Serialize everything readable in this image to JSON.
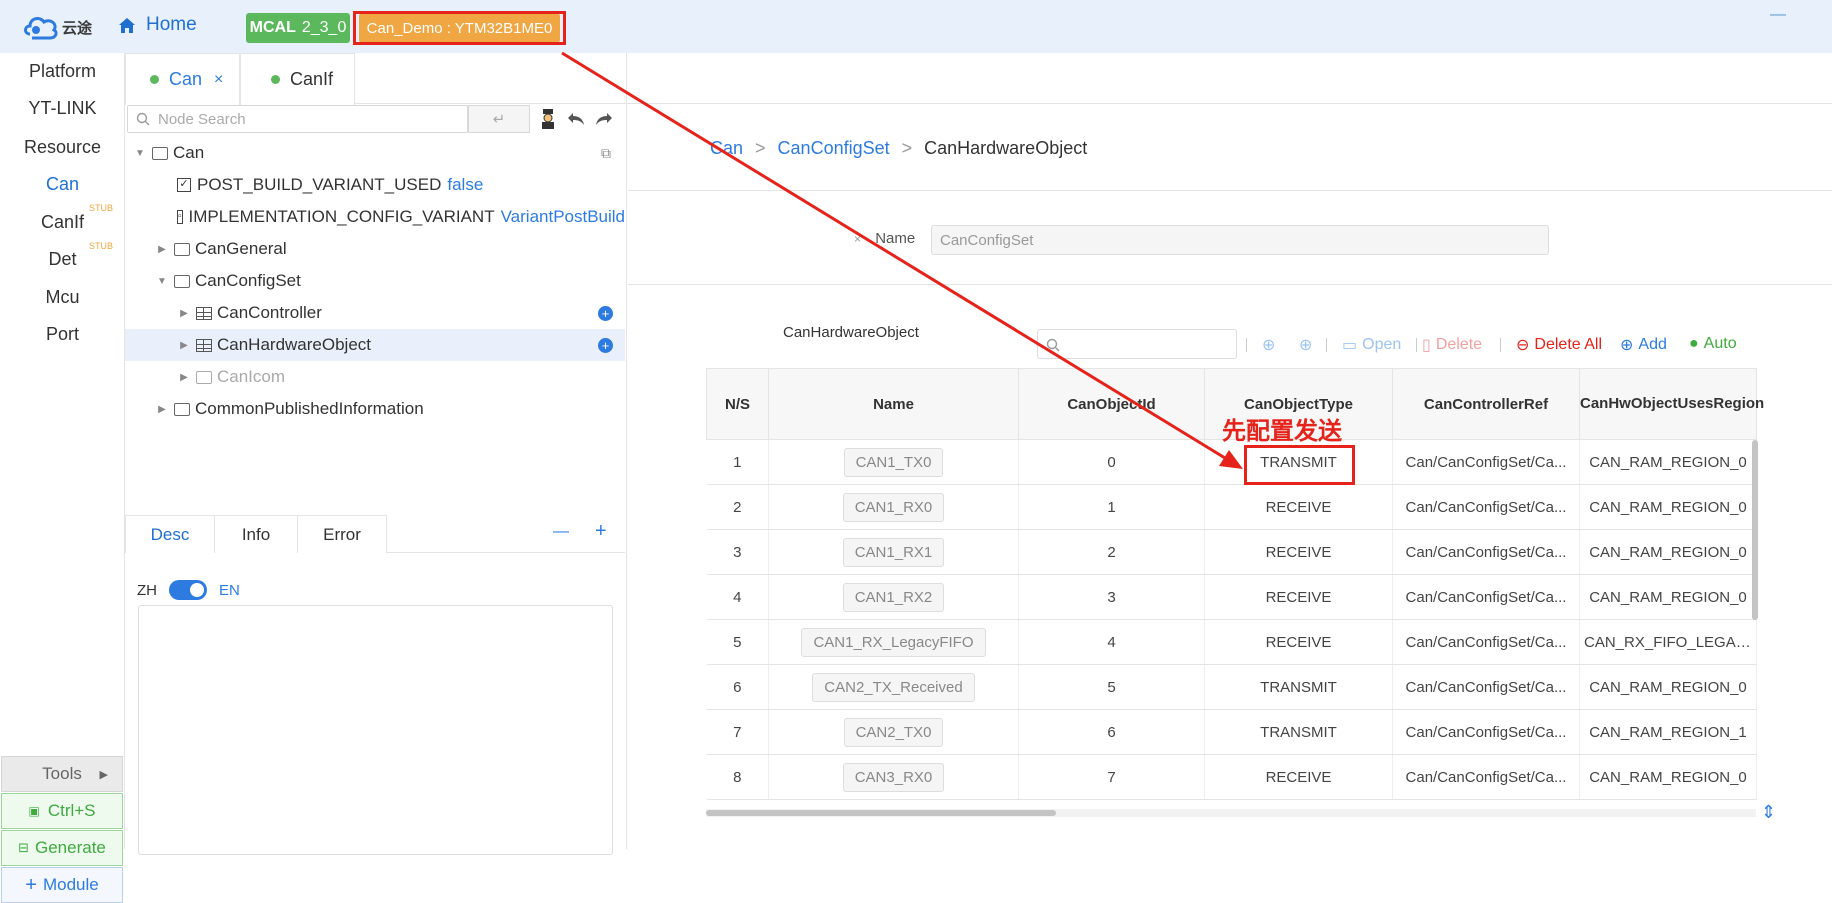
{
  "topbar": {
    "logo_text": "云途",
    "home_label": "Home",
    "mcal_prefix": "MCAL",
    "mcal_version": "2_3_0",
    "project_label": "Can_Demo : YTM32B1ME0"
  },
  "sidenav": {
    "items": [
      {
        "label": "Platform"
      },
      {
        "label": "YT-LINK"
      },
      {
        "label": "Resource"
      },
      {
        "label": "Can"
      },
      {
        "label": "CanIf"
      },
      {
        "label": "Det"
      },
      {
        "label": "Mcu"
      },
      {
        "label": "Port"
      }
    ],
    "stub_label": "STUB",
    "tools_label": "Tools",
    "save_label": "Ctrl+S",
    "generate_label": "Generate",
    "module_label": "Module"
  },
  "tabs": [
    {
      "label": "Can",
      "close": "×"
    },
    {
      "label": "CanIf"
    }
  ],
  "tree": {
    "search_placeholder": "Node Search",
    "enter_glyph": "↵",
    "rows": [
      {
        "label": "Can"
      },
      {
        "label": "POST_BUILD_VARIANT_USED",
        "value": "false"
      },
      {
        "label": "IMPLEMENTATION_CONFIG_VARIANT",
        "value": "VariantPostBuild"
      },
      {
        "label": "CanGeneral"
      },
      {
        "label": "CanConfigSet"
      },
      {
        "label": "CanController"
      },
      {
        "label": "CanHardwareObject"
      },
      {
        "label": "CanIcom"
      },
      {
        "label": "CommonPublishedInformation"
      }
    ]
  },
  "desc_panel": {
    "tabs": [
      "Desc",
      "Info",
      "Error"
    ],
    "minus": "—",
    "plus": "+",
    "lang_left": "ZH",
    "lang_right": "EN"
  },
  "breadcrumb": {
    "items": [
      "Can",
      "CanConfigSet",
      "CanHardwareObject"
    ],
    "sep": ">"
  },
  "form": {
    "required_mark": "×",
    "name_label": "Name",
    "name_value": "CanConfigSet"
  },
  "table_section": {
    "label": "CanHardwareObject",
    "toolbar": {
      "open": "Open",
      "delete": "Delete",
      "delete_all": "Delete All",
      "add": "Add",
      "auto": "Auto"
    },
    "columns": [
      "N/S",
      "Name",
      "CanObjectId",
      "CanObjectType",
      "CanControllerRef",
      "CanHwObjectUsesRegion"
    ],
    "rows": [
      {
        "ns": "1",
        "name": "CAN1_TX0",
        "id": "0",
        "type": "TRANSMIT",
        "ref": "Can/CanConfigSet/Ca...",
        "region": "CAN_RAM_REGION_0"
      },
      {
        "ns": "2",
        "name": "CAN1_RX0",
        "id": "1",
        "type": "RECEIVE",
        "ref": "Can/CanConfigSet/Ca...",
        "region": "CAN_RAM_REGION_0"
      },
      {
        "ns": "3",
        "name": "CAN1_RX1",
        "id": "2",
        "type": "RECEIVE",
        "ref": "Can/CanConfigSet/Ca...",
        "region": "CAN_RAM_REGION_0"
      },
      {
        "ns": "4",
        "name": "CAN1_RX2",
        "id": "3",
        "type": "RECEIVE",
        "ref": "Can/CanConfigSet/Ca...",
        "region": "CAN_RAM_REGION_0"
      },
      {
        "ns": "5",
        "name": "CAN1_RX_LegacyFIFO",
        "id": "4",
        "type": "RECEIVE",
        "ref": "Can/CanConfigSet/Ca...",
        "region": "CAN_RX_FIFO_LEGACY"
      },
      {
        "ns": "6",
        "name": "CAN2_TX_Received",
        "id": "5",
        "type": "TRANSMIT",
        "ref": "Can/CanConfigSet/Ca...",
        "region": "CAN_RAM_REGION_0"
      },
      {
        "ns": "7",
        "name": "CAN2_TX0",
        "id": "6",
        "type": "TRANSMIT",
        "ref": "Can/CanConfigSet/Ca...",
        "region": "CAN_RAM_REGION_1"
      },
      {
        "ns": "8",
        "name": "CAN3_RX0",
        "id": "7",
        "type": "RECEIVE",
        "ref": "Can/CanConfigSet/Ca...",
        "region": "CAN_RAM_REGION_0"
      }
    ]
  },
  "annotation": {
    "text": "先配置发送",
    "color": "#e5231b"
  },
  "colors": {
    "accent": "#2d7be0",
    "green": "#5cb85c",
    "orange": "#f0a642",
    "red": "#e5231b"
  }
}
